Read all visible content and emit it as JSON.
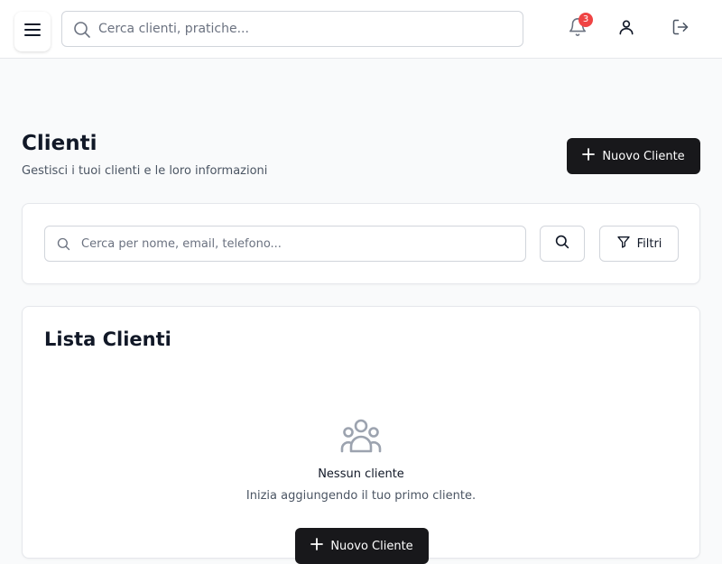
{
  "header": {
    "search_placeholder": "Cerca clienti, pratiche...",
    "notifications_count": "3"
  },
  "page": {
    "title": "Clienti",
    "subtitle": "Gestisci i tuoi clienti e le loro informazioni",
    "new_client_label": "Nuovo Cliente"
  },
  "filters": {
    "search_placeholder": "Cerca per nome, email, telefono...",
    "filter_label": "Filtri"
  },
  "list": {
    "title": "Lista Clienti",
    "empty_title": "Nessun cliente",
    "empty_description": "Inizia aggiungendo il tuo primo cliente.",
    "empty_button_label": "Nuovo Cliente"
  },
  "icons": {
    "menu": "menu-icon",
    "search": "search-icon",
    "bell": "bell-icon",
    "user": "user-icon",
    "logout": "logout-icon",
    "plus": "plus-icon",
    "filter": "filter-icon",
    "users": "users-icon"
  },
  "colors": {
    "primary": "#18181b",
    "badge": "#ef4444",
    "background": "#f9fafb"
  }
}
